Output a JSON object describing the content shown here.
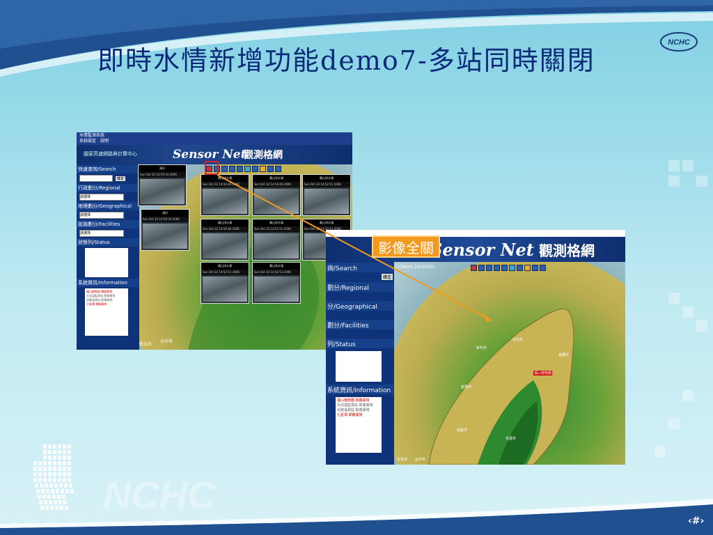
{
  "slide": {
    "title": "即時水情新增功能demo7-多站同時關閉",
    "page_marker": "‹#›",
    "logo_text": "NCHC",
    "watermark_text": "NCHC"
  },
  "left_shot": {
    "menubar": [
      "系統設定",
      "說明"
    ],
    "window_caption": "水情監測系統",
    "banner_sub": "國家高速網路與計算中心",
    "banner_title": "Sensor Net",
    "banner_title_cn": "觀測格網",
    "sections": {
      "search": "快速查詢/Search",
      "regional": "行政劃分/Regional",
      "geographical": "地理劃分/Geographical",
      "facilities": "設施劃分/Facilities",
      "status": "狀態列/Status",
      "information": "系統資訊/Information"
    },
    "search_button": "確定",
    "select_placeholder": "請選擇",
    "info_lines": [
      "福山植物園 網路異常",
      "大坑溪監測站 影像異常",
      "北勢溪測站 影像異常",
      "七星潭 網路異常"
    ],
    "cameras": [
      {
        "name": "頭份",
        "time": "Sun Oct 22 14:59:33 2006"
      },
      {
        "name": "壽山排水溝",
        "time": "Sun Oct 22 14:54:46 2006"
      },
      {
        "name": "壽山排水溝",
        "time": "Sun Oct 22 14:54:46 2006"
      },
      {
        "name": "壽山排水溝",
        "time": "Sun Oct 22 14:52:51 2006"
      },
      {
        "name": "頭份",
        "time": "Sun Oct 22 14:59:34 2006"
      },
      {
        "name": "壽山排水溝",
        "time": "Sun Oct 22 14:54:46 2006"
      },
      {
        "name": "壽山排水溝",
        "time": "Sun Oct 22 14:52:51 2006"
      },
      {
        "name": "壽山排水溝",
        "time": "Sun Oct 22 14:52:51 2006"
      },
      {
        "name": "壽山排水溝",
        "time": "Sun Oct 22 14:52:51 2006"
      },
      {
        "name": "壽山排水溝",
        "time": "Sun Oct 22 14:52:51 2006"
      }
    ],
    "map_labels": [
      "台中市",
      "彰化市"
    ]
  },
  "right_shot": {
    "banner_title": "Sensor Net",
    "banner_title_cn": "觀測格網",
    "coords": "(238441,2618500)",
    "sections": {
      "search": "詢/Search",
      "regional": "劃分/Regional",
      "geographical": "分/Geographical",
      "facilities": "劃分/Facilities",
      "status": "列/Status",
      "information": "系統資訊/Information"
    },
    "search_button": "確定",
    "info_lines": [
      "福山植物園 網路異常",
      "大坑溪監測站 影像異常",
      "北勢溪測站 影像異常",
      "七星潭 網路異常"
    ],
    "map_labels": [
      "台北市",
      "福山植物園",
      "宜蘭市",
      "新竹市",
      "苗栗市",
      "台中市",
      "彰化市",
      "南投市",
      "花蓮市"
    ]
  },
  "callout": "影像全關"
}
